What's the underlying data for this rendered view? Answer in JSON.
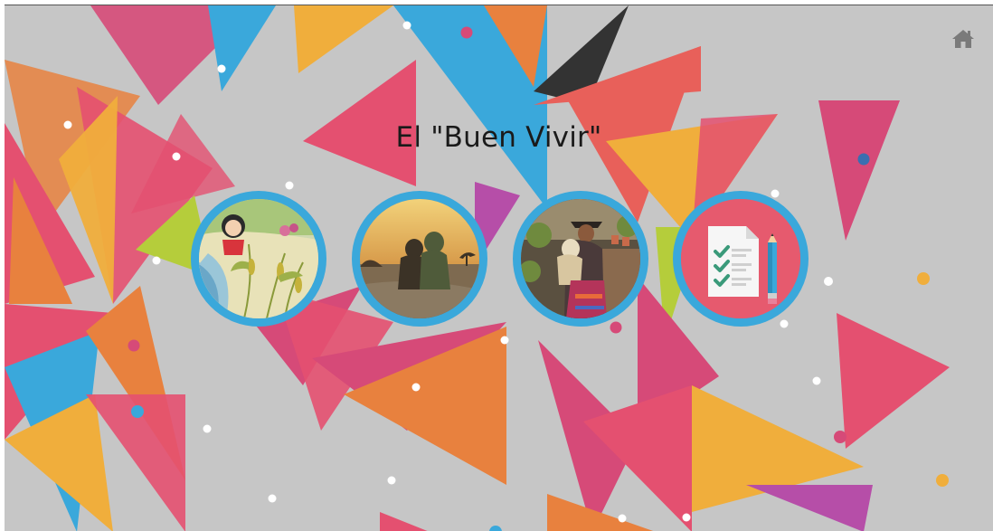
{
  "page": {
    "title": "El \"Buen Vivir\""
  },
  "colors": {
    "background": "#c6c6c6",
    "circle_border": "#3aa8db",
    "title_text": "#1a1a1a"
  },
  "icons": {
    "home": "home-icon",
    "checklist": "checklist-icon",
    "pencil": "pencil-icon"
  },
  "menu": {
    "items": [
      {
        "name": "illustration-girl-cornfield",
        "kind": "image"
      },
      {
        "name": "photo-people-sunset",
        "kind": "image"
      },
      {
        "name": "photo-woman-with-child",
        "kind": "image"
      },
      {
        "name": "activity-checklist",
        "kind": "icon"
      }
    ]
  }
}
